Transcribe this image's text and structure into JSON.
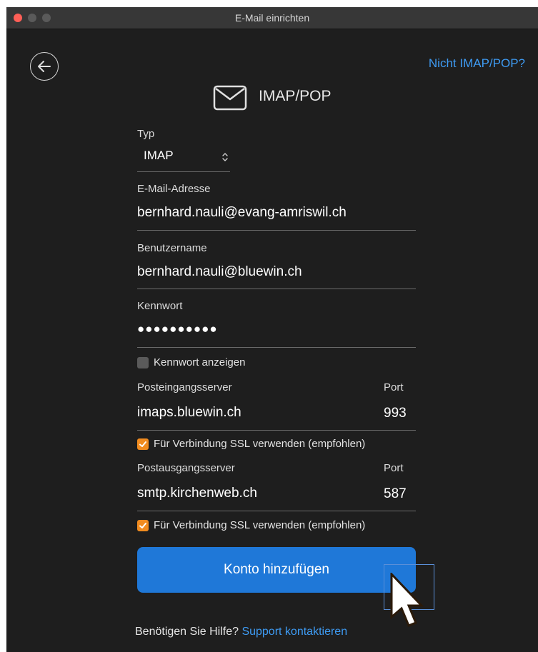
{
  "window": {
    "title": "E-Mail einrichten"
  },
  "nav": {
    "not_imap_link": "Nicht IMAP/POP?"
  },
  "header": {
    "title": "IMAP/POP",
    "icon": "envelope-icon"
  },
  "form": {
    "type_label": "Typ",
    "type_value": "IMAP",
    "email_label": "E-Mail-Adresse",
    "email_value": "bernhard.nauli@evang-amriswil.ch",
    "username_label": "Benutzername",
    "username_value": "bernhard.nauli@bluewin.ch",
    "password_label": "Kennwort",
    "password_value": "●●●●●●●●●●",
    "show_password_label": "Kennwort anzeigen",
    "show_password_checked": false,
    "incoming_label": "Posteingangsserver",
    "incoming_port_label": "Port",
    "incoming_server": "imaps.bluewin.ch",
    "incoming_port": "993",
    "incoming_ssl_label": "Für Verbindung SSL verwenden (empfohlen)",
    "incoming_ssl_checked": true,
    "outgoing_label": "Postausgangsserver",
    "outgoing_port_label": "Port",
    "outgoing_server": "smtp.kirchenweb.ch",
    "outgoing_port": "587",
    "outgoing_ssl_label": "Für Verbindung SSL verwenden (empfohlen)",
    "outgoing_ssl_checked": true,
    "submit_label": "Konto hinzufügen"
  },
  "help": {
    "question": "Benötigen Sie Hilfe?",
    "link": "Support kontaktieren"
  },
  "colors": {
    "accent": "#1f78d8",
    "link": "#3e9bf3",
    "checkbox": "#f08b1f",
    "background": "#1e1e1e"
  }
}
